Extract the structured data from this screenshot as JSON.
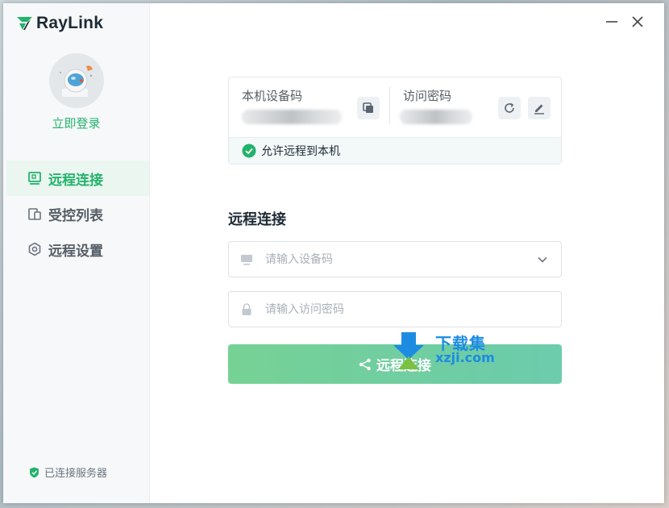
{
  "app": {
    "name": "RayLink",
    "accent_color": "#22b36b"
  },
  "sidebar": {
    "login_label": "立即登录",
    "items": [
      {
        "label": "远程连接",
        "icon": "monitor-icon",
        "active": true
      },
      {
        "label": "受控列表",
        "icon": "devices-icon",
        "active": false
      },
      {
        "label": "远程设置",
        "icon": "hexagon-settings-icon",
        "active": false
      }
    ],
    "server_status": "已连接服务器"
  },
  "device_card": {
    "device_code_label": "本机设备码",
    "access_password_label": "访问密码",
    "allow_remote_label": "允许远程到本机"
  },
  "connect": {
    "section_title": "远程连接",
    "device_placeholder": "请输入设备码",
    "password_placeholder": "请输入访问密码",
    "connect_button_label": "远程连接"
  },
  "watermark": {
    "line1": "下载集",
    "line2": "xzji.com"
  }
}
